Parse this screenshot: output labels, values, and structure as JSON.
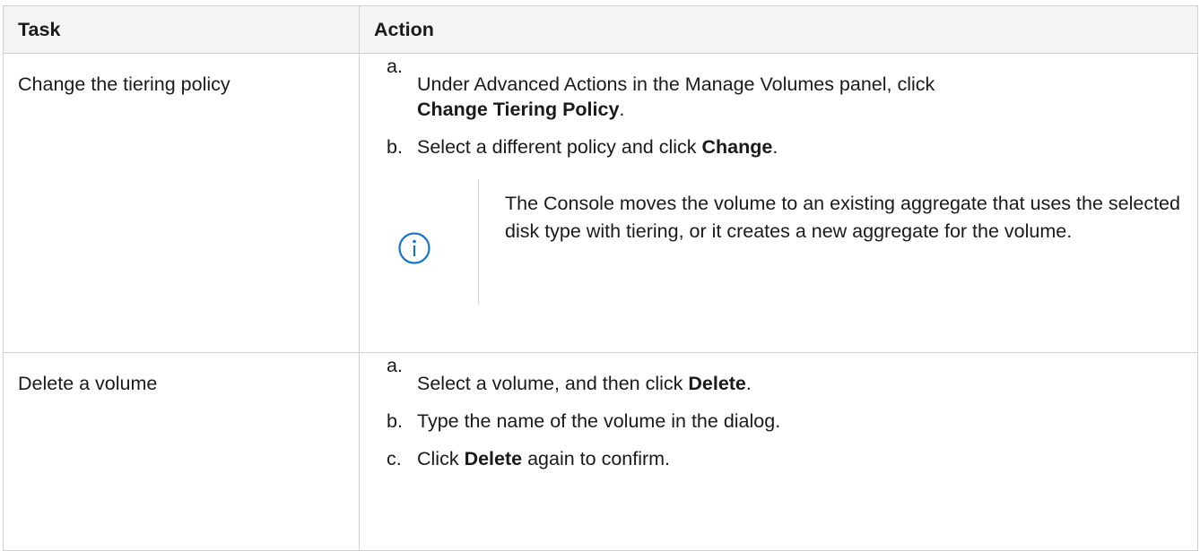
{
  "header": {
    "task": "Task",
    "action": "Action"
  },
  "rows": [
    {
      "task": "Change the tiering policy",
      "steps": [
        {
          "marker": "a.",
          "pre": "Under Advanced Actions in the Manage Volumes panel, click",
          "bold": "Change Tiering Policy",
          "post": "."
        },
        {
          "marker": "b.",
          "pre": "Select a different policy and click ",
          "bold": "Change",
          "post": "."
        }
      ],
      "note": {
        "icon": "info-icon",
        "text": "The Console moves the volume to an existing aggregate that uses the selected disk type with tiering, or it creates a new aggregate for the volume."
      }
    },
    {
      "task": "Delete a volume",
      "steps": [
        {
          "marker": "a.",
          "pre": "Select a volume, and then click ",
          "bold": "Delete",
          "post": "."
        },
        {
          "marker": "b.",
          "text": "Type the name of the volume in the dialog."
        },
        {
          "marker": "c.",
          "pre": "Click ",
          "bold": "Delete",
          "post": " again to confirm."
        }
      ]
    }
  ],
  "colors": {
    "border": "#cfcfcf",
    "header_bg": "#f4f4f4",
    "icon": "#1a73c7"
  }
}
